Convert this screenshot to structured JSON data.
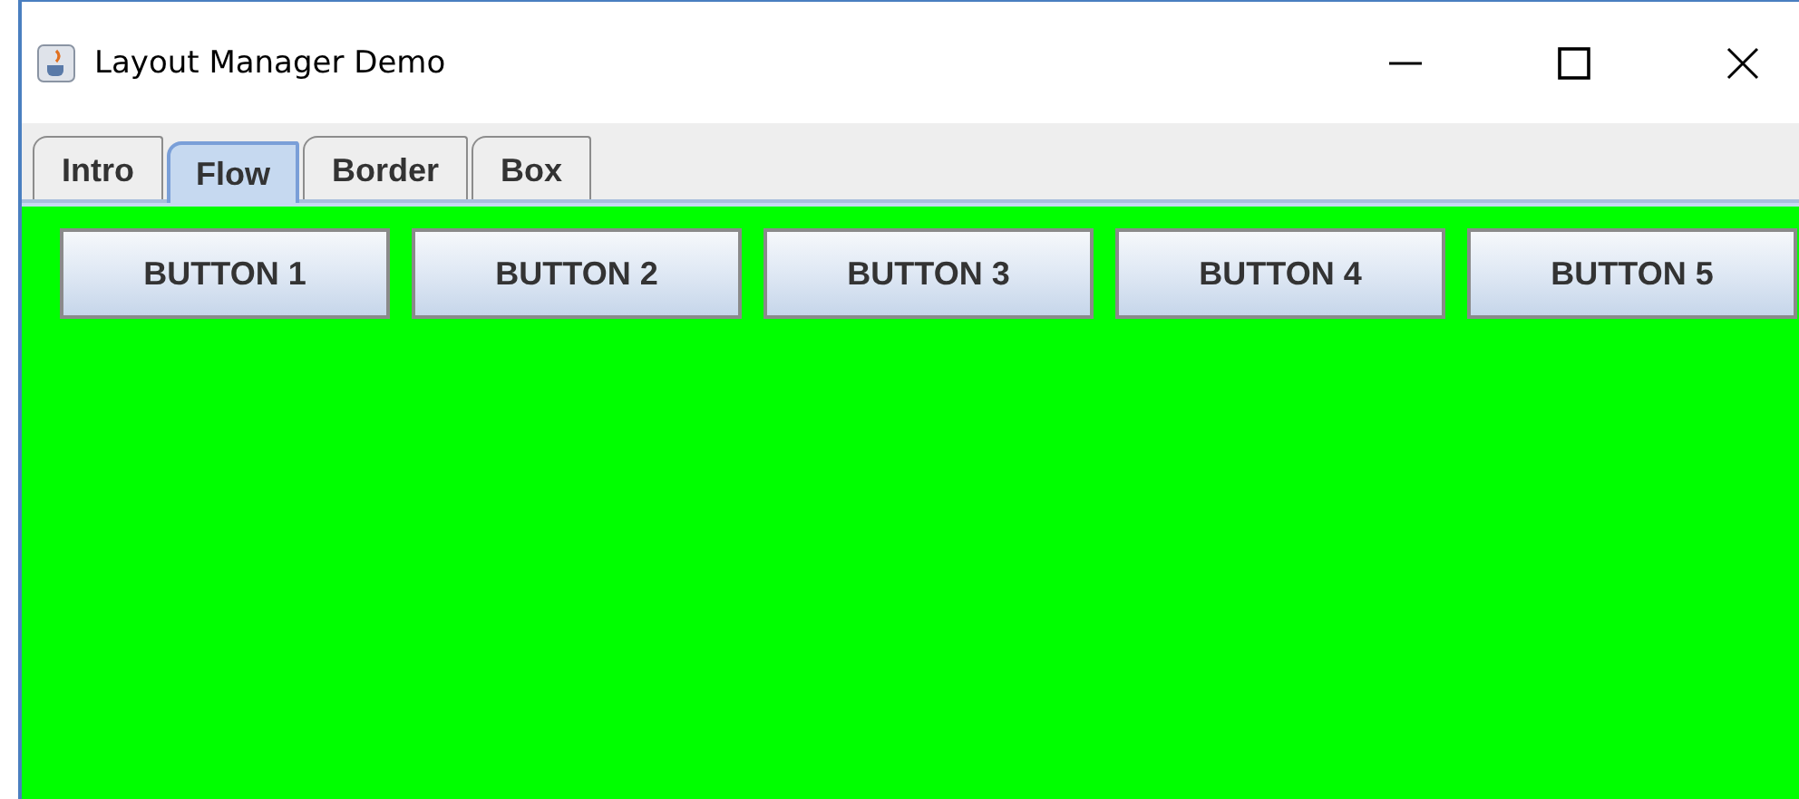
{
  "window": {
    "title": "Layout Manager Demo"
  },
  "tabs": [
    {
      "label": "Intro",
      "selected": false
    },
    {
      "label": "Flow",
      "selected": true
    },
    {
      "label": "Border",
      "selected": false
    },
    {
      "label": "Box",
      "selected": false
    }
  ],
  "buttons": [
    "BUTTON 1",
    "BUTTON 2",
    "BUTTON 3",
    "BUTTON 4",
    "BUTTON 5"
  ]
}
